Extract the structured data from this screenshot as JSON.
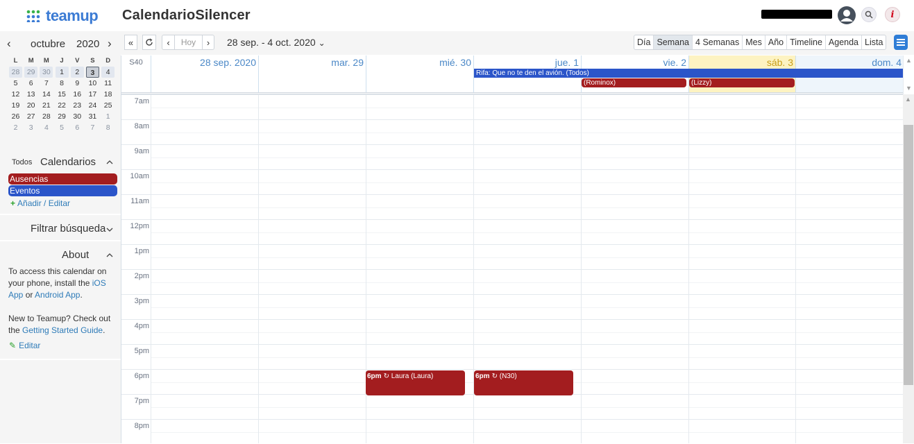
{
  "header": {
    "logo": "teamup",
    "title": "CalendarioSilencer"
  },
  "mini_calendar": {
    "month": "octubre",
    "year": "2020",
    "weekday_headers": [
      "L",
      "M",
      "M",
      "J",
      "V",
      "S",
      "D"
    ],
    "weeks": [
      [
        "28",
        "29",
        "30",
        "1",
        "2",
        "3",
        "4"
      ],
      [
        "5",
        "6",
        "7",
        "8",
        "9",
        "10",
        "11"
      ],
      [
        "12",
        "13",
        "14",
        "15",
        "16",
        "17",
        "18"
      ],
      [
        "19",
        "20",
        "21",
        "22",
        "23",
        "24",
        "25"
      ],
      [
        "26",
        "27",
        "28",
        "29",
        "30",
        "31",
        "1"
      ],
      [
        "2",
        "3",
        "4",
        "5",
        "6",
        "7",
        "8"
      ]
    ]
  },
  "calendars": {
    "todos": "Todos",
    "title": "Calendarios",
    "items": [
      {
        "label": "Ausencias",
        "color": "#a31d1f"
      },
      {
        "label": "Eventos",
        "color": "#2b55c9"
      }
    ],
    "add_label": "Añadir / Editar"
  },
  "filter": {
    "label": "Filtrar búsqueda"
  },
  "about": {
    "title": "About",
    "line1": "To access this calendar on your phone, install the ",
    "ios": "iOS App",
    "or": " or ",
    "android": "Android App",
    "dot": ".",
    "line2": "New to Teamup? Check out the ",
    "guide": "Getting Started Guide",
    "edit": "Editar"
  },
  "toolbar": {
    "today": "Hoy",
    "range": "28 sep. - 4 oct. 2020",
    "views": [
      "Día",
      "Semana",
      "4 Semanas",
      "Mes",
      "Año",
      "Timeline",
      "Agenda",
      "Lista"
    ],
    "active_view": "Semana"
  },
  "week": {
    "label": "S40",
    "days": [
      "28 sep. 2020",
      "mar. 29",
      "mié. 30",
      "jue. 1",
      "vie. 2",
      "sáb. 3",
      "dom. 4"
    ]
  },
  "allday_events": [
    {
      "title": "Rifa: Que no te den el avión. (Todos)"
    },
    {
      "title": "(Rominox)"
    },
    {
      "title": "(Lizzy)"
    }
  ],
  "hours": [
    "7am",
    "8am",
    "9am",
    "10am",
    "11am",
    "12pm",
    "1pm",
    "2pm",
    "3pm",
    "4pm",
    "5pm",
    "6pm",
    "7pm",
    "8pm"
  ],
  "timed_events": [
    {
      "time": "6pm",
      "title": "Laura (Laura)"
    },
    {
      "time": "6pm",
      "title": "(N30)"
    }
  ]
}
